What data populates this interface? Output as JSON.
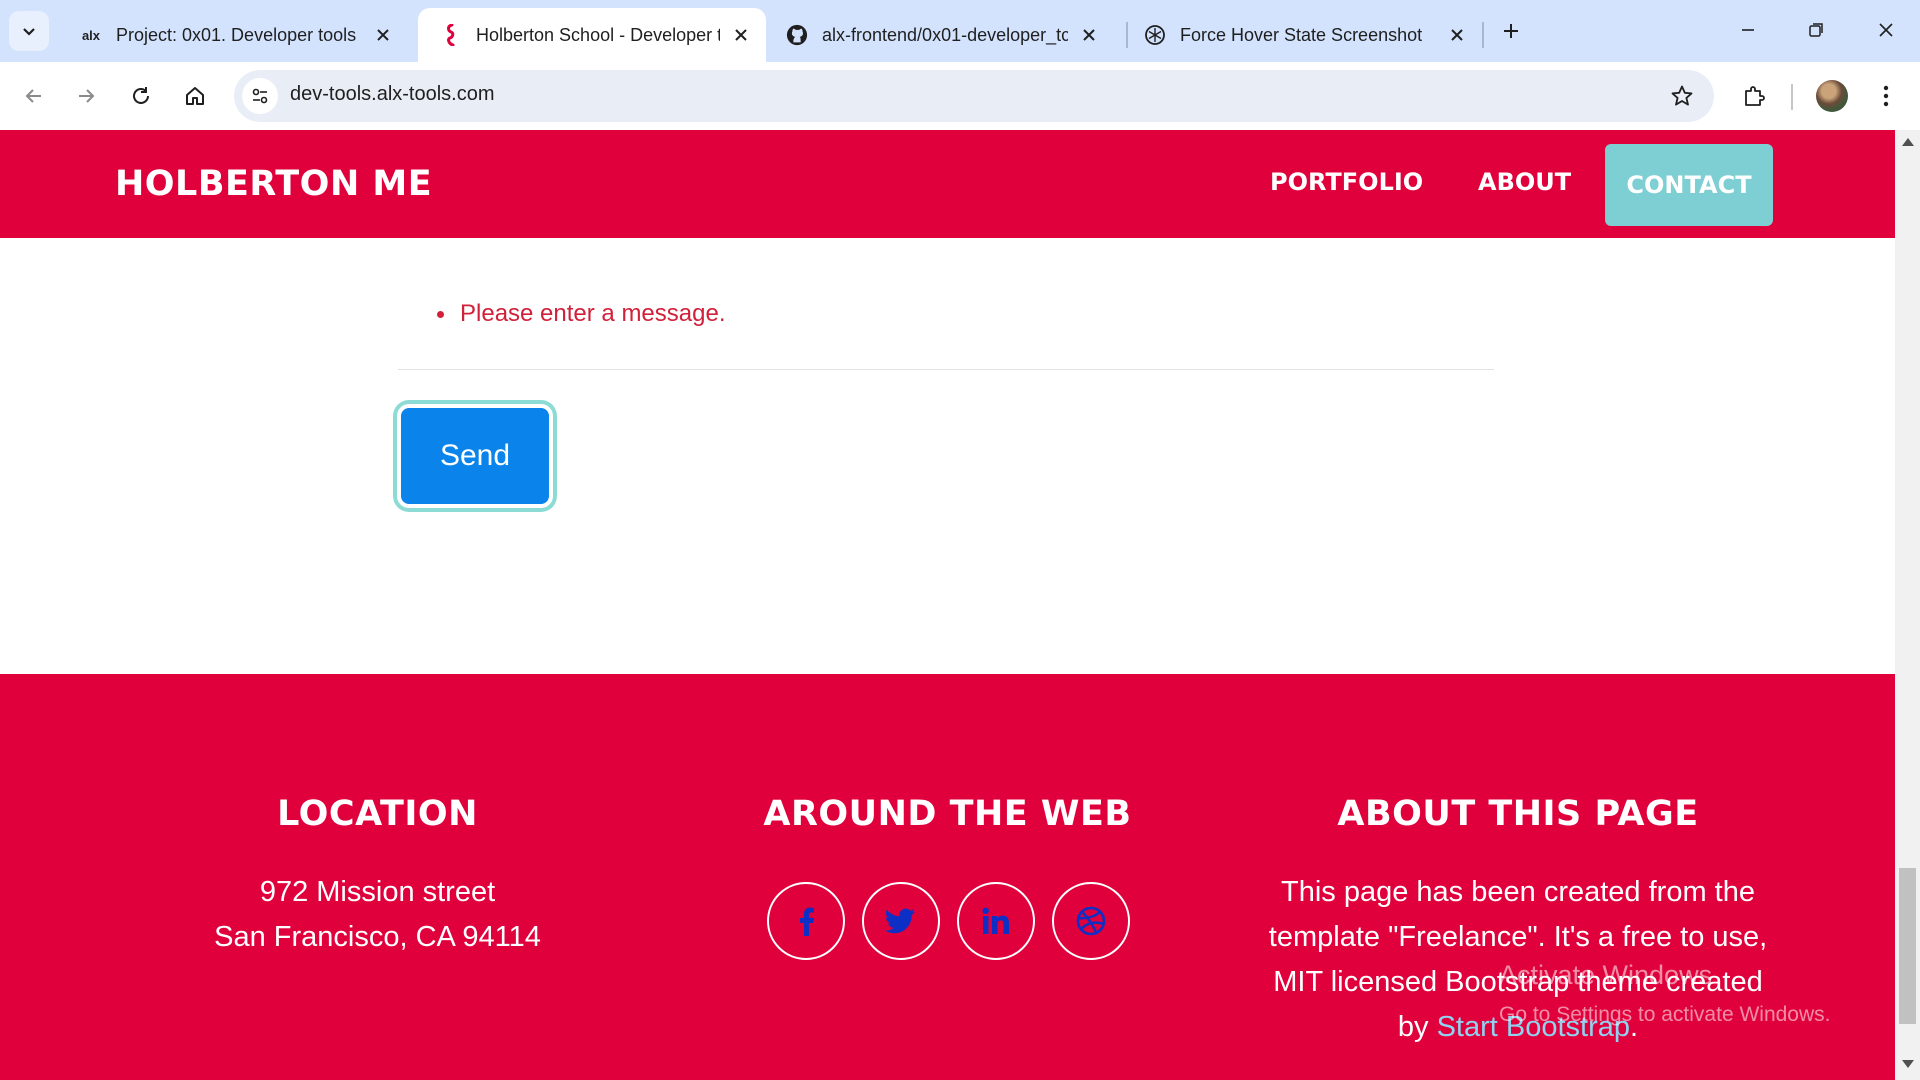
{
  "tabs": [
    {
      "title": "Project: 0x01. Developer tools |",
      "icon": "alx-logo-icon",
      "active": false
    },
    {
      "title": "Holberton School - Developer t",
      "icon": "holberton-seahorse-icon",
      "active": true
    },
    {
      "title": "alx-frontend/0x01-developer_tc",
      "icon": "github-icon",
      "active": false
    },
    {
      "title": "Force Hover State Screenshot",
      "icon": "openai-icon",
      "active": false
    }
  ],
  "alx_logo_text": "alx",
  "address_bar": {
    "url": "dev-tools.alx-tools.com"
  },
  "site": {
    "brand": "HOLBERTON ME",
    "nav": {
      "portfolio": "PORTFOLIO",
      "about": "ABOUT",
      "contact": "CONTACT"
    }
  },
  "form": {
    "error_message": "Please enter a message.",
    "send_label": "Send"
  },
  "footer": {
    "location": {
      "heading": "LOCATION",
      "line1": "972 Mission street",
      "line2": "San Francisco, CA 94114"
    },
    "web": {
      "heading": "AROUND THE WEB",
      "icons": [
        "facebook-icon",
        "twitter-icon",
        "linkedin-icon",
        "dribbble-icon"
      ]
    },
    "about": {
      "heading": "ABOUT THIS PAGE",
      "line1": "This page has been created from the",
      "line2": "template \"Freelance\". It's a free to use,",
      "line3": "MIT licensed Bootstrap theme created",
      "line4_prefix": "by",
      "link": "Start Bootstrap",
      "line4_suffix": "."
    }
  },
  "watermark": {
    "title": "Activate Windows",
    "subtitle": "Go to Settings to activate Windows."
  },
  "colors": {
    "brand_red": "#e0003c",
    "contact_teal": "#7dcfd4",
    "send_blue": "#0a83ea",
    "error_red": "#d1213a"
  }
}
